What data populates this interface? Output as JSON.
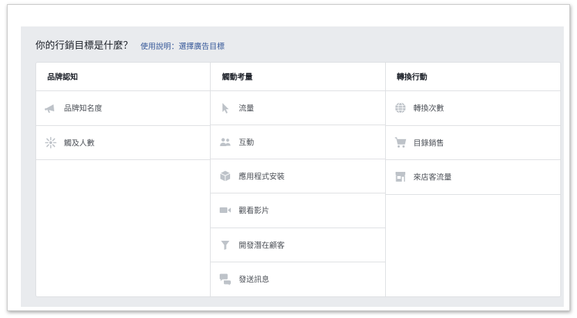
{
  "question": "你的行銷目標是什麼？",
  "help_link": "使用說明：選擇廣告目標",
  "colors": {
    "link": "#365899",
    "icon": "#bec3c9",
    "border": "#dddfe2",
    "panel": "#e9ebee"
  },
  "columns": [
    {
      "header": "品牌認知",
      "items": [
        {
          "label": "品牌知名度",
          "icon": "megaphone-icon"
        },
        {
          "label": "觸及人數",
          "icon": "burst-icon"
        }
      ]
    },
    {
      "header": "觸動考量",
      "items": [
        {
          "label": "流量",
          "icon": "cursor-icon"
        },
        {
          "label": "互動",
          "icon": "people-icon"
        },
        {
          "label": "應用程式安裝",
          "icon": "cube-icon"
        },
        {
          "label": "觀看影片",
          "icon": "video-camera-icon"
        },
        {
          "label": "開發潛在顧客",
          "icon": "funnel-icon"
        },
        {
          "label": "發送訊息",
          "icon": "chat-bubbles-icon"
        }
      ]
    },
    {
      "header": "轉換行動",
      "items": [
        {
          "label": "轉換次數",
          "icon": "globe-icon"
        },
        {
          "label": "目錄銷售",
          "icon": "shopping-cart-icon"
        },
        {
          "label": "來店客流量",
          "icon": "storefront-icon"
        }
      ]
    }
  ]
}
